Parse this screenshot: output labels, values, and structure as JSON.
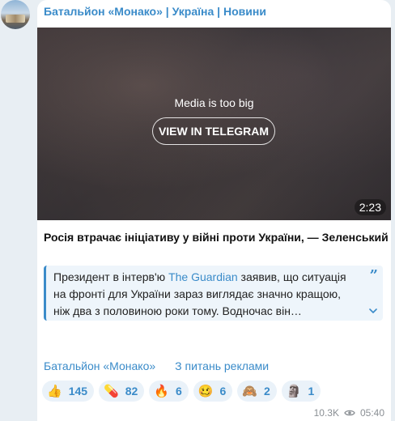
{
  "channel": {
    "name": "Батальйон «Монако» | Україна | Новини"
  },
  "media": {
    "note": "Media is too big",
    "button_label": "VIEW IN TELEGRAM",
    "duration": "2:23"
  },
  "post": {
    "headline": "Росія втрачає ініціативу у війні проти України, — Зеленський",
    "quote": {
      "part1": "Президент в інтерв'ю ",
      "link": "The Guardian",
      "part2": " заявив, що ситуація на фронті для України зараз виглядає значно кращою, ніж два з половиною роки тому. Водночас він…"
    }
  },
  "footer": {
    "channel_link": "Батальйон «Монако»",
    "ads_link": "З питань реклами"
  },
  "reactions": [
    {
      "emoji": "👍",
      "count": "145",
      "icon": "thumbs-up-icon"
    },
    {
      "emoji": "💊",
      "count": "82",
      "icon": "pill-icon"
    },
    {
      "emoji": "🔥",
      "count": "6",
      "icon": "fire-icon"
    },
    {
      "emoji": "🥴",
      "count": "6",
      "icon": "woozy-face-icon"
    },
    {
      "emoji": "🙈",
      "count": "2",
      "icon": "see-no-evil-monkey-icon"
    },
    {
      "emoji": "🗿",
      "count": "1",
      "icon": "moai-icon"
    }
  ],
  "meta": {
    "views": "10.3K",
    "time": "05:40"
  },
  "colors": {
    "accent": "#3a8bc9",
    "background": "#e8eef3",
    "bubble": "#ffffff"
  }
}
